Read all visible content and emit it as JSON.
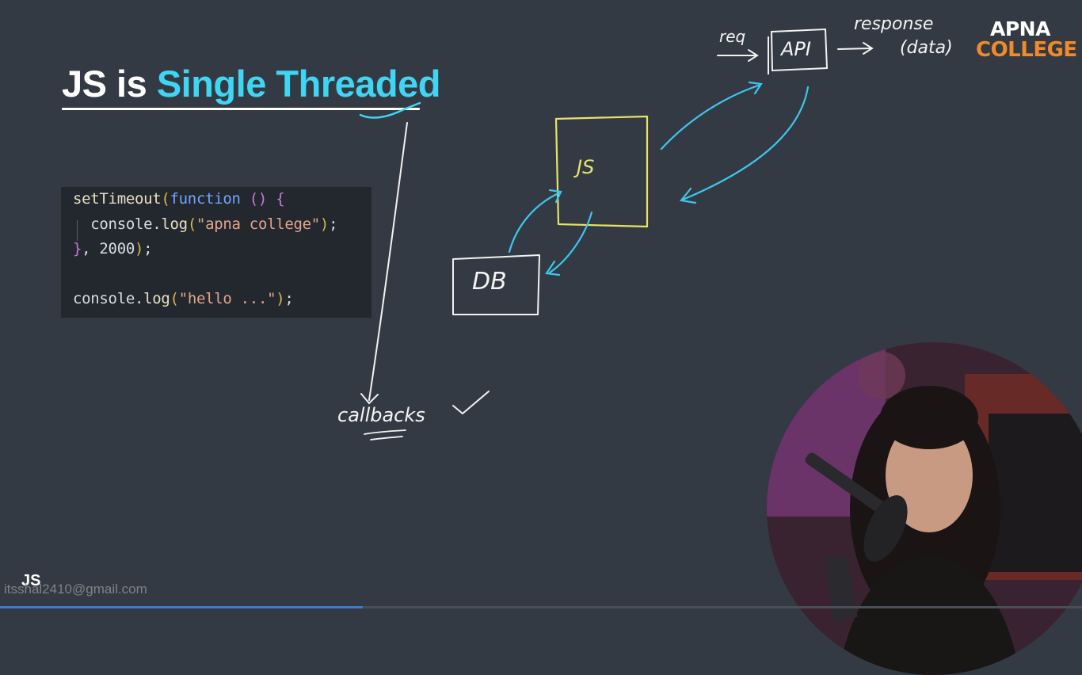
{
  "slide": {
    "title_prefix": "JS is ",
    "title_accent": "Single Threaded",
    "colors": {
      "background": "#343a43",
      "accent": "#3fd6f4",
      "js_box": "#e7e36a",
      "arrows": "#3cc7ee",
      "logo_orange": "#f18a2a"
    }
  },
  "code": {
    "lines": [
      [
        {
          "t": "setTimeout",
          "c": "fn"
        },
        {
          "t": "(",
          "c": "paren"
        },
        {
          "t": "function",
          "c": "kw"
        },
        {
          "t": " ",
          "c": "plain"
        },
        {
          "t": "()",
          "c": "paren2"
        },
        {
          "t": " ",
          "c": "plain"
        },
        {
          "t": "{",
          "c": "paren2"
        }
      ],
      [
        {
          "t": "  console",
          "c": "plain"
        },
        {
          "t": ".",
          "c": "plain"
        },
        {
          "t": "log",
          "c": "fn"
        },
        {
          "t": "(",
          "c": "paren"
        },
        {
          "t": "\"apna college\"",
          "c": "str"
        },
        {
          "t": ")",
          "c": "paren"
        },
        {
          "t": ";",
          "c": "plain"
        }
      ],
      [
        {
          "t": "}",
          "c": "paren2"
        },
        {
          "t": ", ",
          "c": "plain"
        },
        {
          "t": "2000",
          "c": "num"
        },
        {
          "t": ")",
          "c": "paren"
        },
        {
          "t": ";",
          "c": "plain"
        }
      ],
      [],
      [
        {
          "t": "console",
          "c": "plain"
        },
        {
          "t": ".",
          "c": "plain"
        },
        {
          "t": "log",
          "c": "fn"
        },
        {
          "t": "(",
          "c": "paren"
        },
        {
          "t": "\"hello ...\"",
          "c": "str"
        },
        {
          "t": ")",
          "c": "paren"
        },
        {
          "t": ";",
          "c": "plain"
        }
      ]
    ]
  },
  "diagram": {
    "js_label": "JS",
    "db_label": "DB",
    "api_label": "API",
    "req_label": "req",
    "response_label": "response",
    "data_label": "(data)",
    "callbacks_label": "callbacks"
  },
  "logo": {
    "line1": "APNA",
    "line2": "COLLEGE"
  },
  "footer": {
    "section": "JS",
    "email": "itsshal2410@gmail.com",
    "progress": 0.335
  }
}
